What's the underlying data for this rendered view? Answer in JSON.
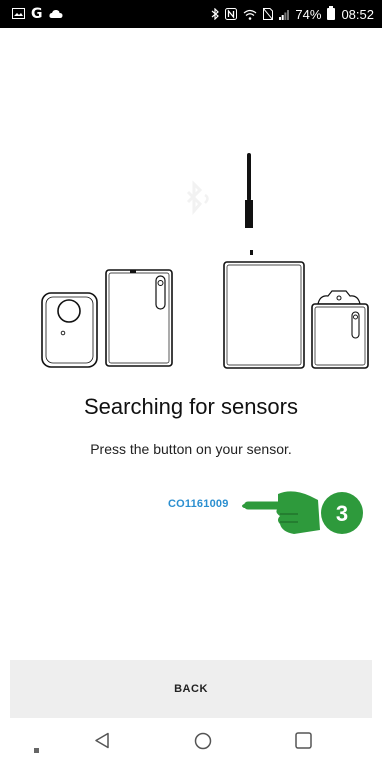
{
  "status_bar": {
    "left_icons": [
      "image-icon",
      "google-g-icon",
      "cloud-icon"
    ],
    "google_letter": "G",
    "right_icons": [
      "bluetooth-icon",
      "nfc-icon",
      "wifi-icon",
      "no-sim-icon",
      "signal-icon"
    ],
    "battery": "74%",
    "time": "08:52"
  },
  "illustration": {
    "icons": [
      "bluetooth-icon",
      "sensor-device-small-icon",
      "sensor-device-tall-icon",
      "antenna-gateway-icon",
      "sensor-device-clip-icon"
    ]
  },
  "content": {
    "title": "Searching for sensors",
    "subtitle": "Press the button on your sensor.",
    "sensor_id": "CO1161009",
    "callout_number": "3",
    "callout_color": "#2e9a3c",
    "link_color": "#2b8fd0"
  },
  "footer": {
    "back_label": "BACK"
  },
  "nav": {
    "items": [
      "dot-icon",
      "back-triangle-icon",
      "home-circle-icon",
      "recents-square-icon"
    ]
  }
}
